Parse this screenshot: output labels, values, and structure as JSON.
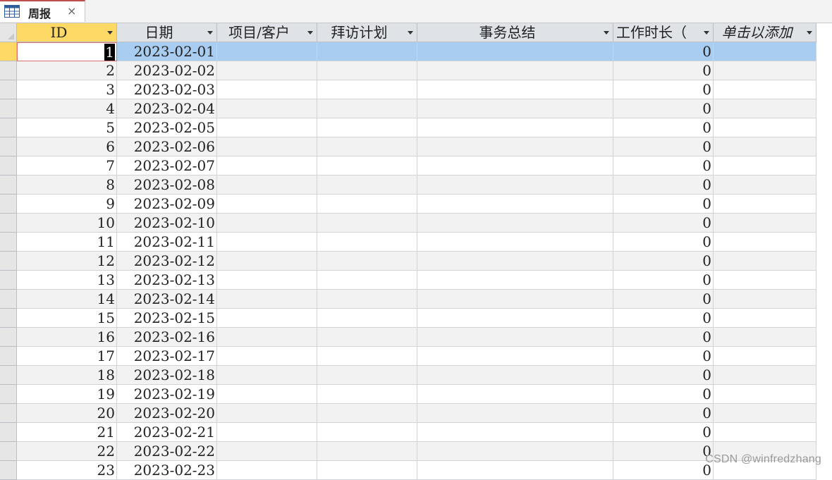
{
  "tab": {
    "label": "周报",
    "close": "×"
  },
  "columns": [
    {
      "key": "id",
      "label": "ID"
    },
    {
      "key": "date",
      "label": "日期"
    },
    {
      "key": "project",
      "label": "项目/客户"
    },
    {
      "key": "visit",
      "label": "拜访计划"
    },
    {
      "key": "summary",
      "label": "事务总结"
    },
    {
      "key": "hours",
      "label": "工作时长（"
    },
    {
      "key": "add",
      "label": "单击以添加"
    }
  ],
  "rows": [
    {
      "id": "1",
      "date": "2023-02-01",
      "hours": "0"
    },
    {
      "id": "2",
      "date": "2023-02-02",
      "hours": "0"
    },
    {
      "id": "3",
      "date": "2023-02-03",
      "hours": "0"
    },
    {
      "id": "4",
      "date": "2023-02-04",
      "hours": "0"
    },
    {
      "id": "5",
      "date": "2023-02-05",
      "hours": "0"
    },
    {
      "id": "6",
      "date": "2023-02-06",
      "hours": "0"
    },
    {
      "id": "7",
      "date": "2023-02-07",
      "hours": "0"
    },
    {
      "id": "8",
      "date": "2023-02-08",
      "hours": "0"
    },
    {
      "id": "9",
      "date": "2023-02-09",
      "hours": "0"
    },
    {
      "id": "10",
      "date": "2023-02-10",
      "hours": "0"
    },
    {
      "id": "11",
      "date": "2023-02-11",
      "hours": "0"
    },
    {
      "id": "12",
      "date": "2023-02-12",
      "hours": "0"
    },
    {
      "id": "13",
      "date": "2023-02-13",
      "hours": "0"
    },
    {
      "id": "14",
      "date": "2023-02-14",
      "hours": "0"
    },
    {
      "id": "15",
      "date": "2023-02-15",
      "hours": "0"
    },
    {
      "id": "16",
      "date": "2023-02-16",
      "hours": "0"
    },
    {
      "id": "17",
      "date": "2023-02-17",
      "hours": "0"
    },
    {
      "id": "18",
      "date": "2023-02-18",
      "hours": "0"
    },
    {
      "id": "19",
      "date": "2023-02-19",
      "hours": "0"
    },
    {
      "id": "20",
      "date": "2023-02-20",
      "hours": "0"
    },
    {
      "id": "21",
      "date": "2023-02-21",
      "hours": "0"
    },
    {
      "id": "22",
      "date": "2023-02-22",
      "hours": "0"
    },
    {
      "id": "23",
      "date": "2023-02-23",
      "hours": "0"
    }
  ],
  "watermark": "CSDN @winfredzhang"
}
